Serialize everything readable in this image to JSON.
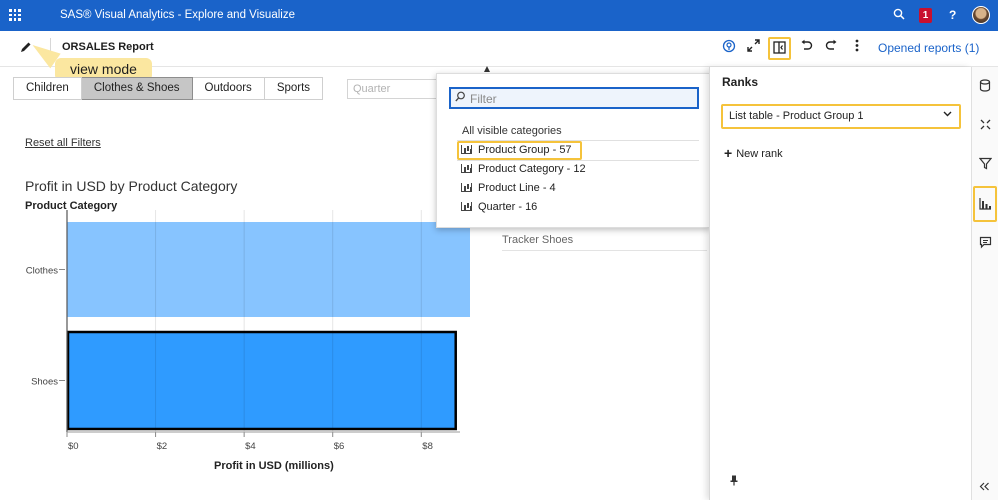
{
  "appbar": {
    "title": "SAS® Visual Analytics - Explore and Visualize",
    "search_icon": "search-icon",
    "notification_count": "1",
    "help_label": "?"
  },
  "toolbar": {
    "report_title": "ORSALES Report",
    "opened_reports": "Opened reports (1)"
  },
  "callout": {
    "text": "view mode"
  },
  "tabs": [
    {
      "label": "Children",
      "active": false
    },
    {
      "label": "Clothes & Shoes",
      "active": true
    },
    {
      "label": "Outdoors",
      "active": false
    },
    {
      "label": "Sports",
      "active": false
    }
  ],
  "quarter_placeholder": "Quarter",
  "reset_filters": "Reset all Filters",
  "behind_item": "Tracker Shoes",
  "popup": {
    "filter_placeholder": "Filter",
    "heading": "All visible categories",
    "items": [
      "Product Group - 57",
      "Product Category - 12",
      "Product Line - 4",
      "Quarter - 16"
    ]
  },
  "ranks_panel": {
    "title": "Ranks",
    "selected": "List table - Product Group 1",
    "new_rank": "New rank"
  },
  "colors": {
    "appbar": "#1a63c9",
    "highlight": "#f5c33b",
    "bar_clothes": "#87c4ff",
    "bar_shoes": "#2f9bff"
  },
  "chart_data": {
    "type": "bar",
    "orientation": "horizontal",
    "title": "Profit in USD by Product Category",
    "ylabel": "Product Category",
    "xlabel": "Profit in USD (millions)",
    "categories": [
      "Clothes",
      "Shoes"
    ],
    "values": [
      9.1,
      8.8
    ],
    "xlim": [
      0,
      9.1
    ],
    "x_ticks": [
      "$0",
      "$2",
      "$4",
      "$6",
      "$8"
    ],
    "x_tick_values": [
      0,
      2,
      4,
      6,
      8
    ],
    "selected_category": "Shoes",
    "grid": true
  }
}
